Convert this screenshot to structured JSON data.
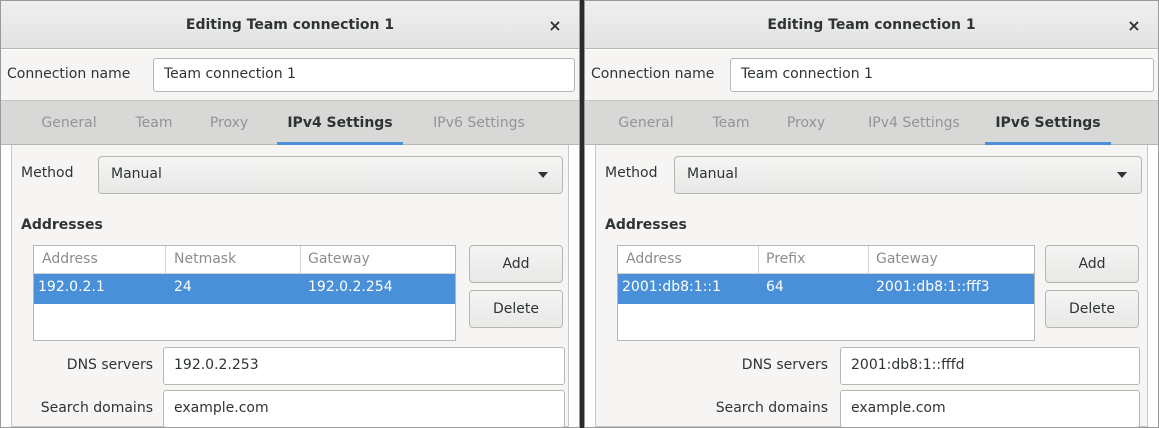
{
  "left": {
    "title": "Editing Team connection 1",
    "close": "×",
    "connection_label": "Connection name",
    "connection_value": "Team connection 1",
    "tabs": [
      "General",
      "Team",
      "Proxy",
      "IPv4 Settings",
      "IPv6 Settings"
    ],
    "active_tab": "IPv4 Settings",
    "method_label": "Method",
    "method_value": "Manual",
    "addresses_title": "Addresses",
    "columns": [
      "Address",
      "Netmask",
      "Gateway"
    ],
    "row": [
      "192.0.2.1",
      "24",
      "192.0.2.254"
    ],
    "add_label": "Add",
    "delete_label": "Delete",
    "dns_label": "DNS servers",
    "dns_value": "192.0.2.253",
    "search_label": "Search domains",
    "search_value": "example.com"
  },
  "right": {
    "title": "Editing Team connection 1",
    "close": "×",
    "connection_label": "Connection name",
    "connection_value": "Team connection 1",
    "tabs": [
      "General",
      "Team",
      "Proxy",
      "IPv4 Settings",
      "IPv6 Settings"
    ],
    "active_tab": "IPv6 Settings",
    "method_label": "Method",
    "method_value": "Manual",
    "addresses_title": "Addresses",
    "columns": [
      "Address",
      "Prefix",
      "Gateway"
    ],
    "row": [
      "2001:db8:1::1",
      "64",
      "2001:db8:1::fff3"
    ],
    "add_label": "Add",
    "delete_label": "Delete",
    "dns_label": "DNS servers",
    "dns_value": "2001:db8:1::fffd",
    "search_label": "Search domains",
    "search_value": "example.com"
  },
  "colors": {
    "accent": "#4a90d9",
    "selection": "#4a90d9",
    "tab_inactive": "#929595"
  }
}
